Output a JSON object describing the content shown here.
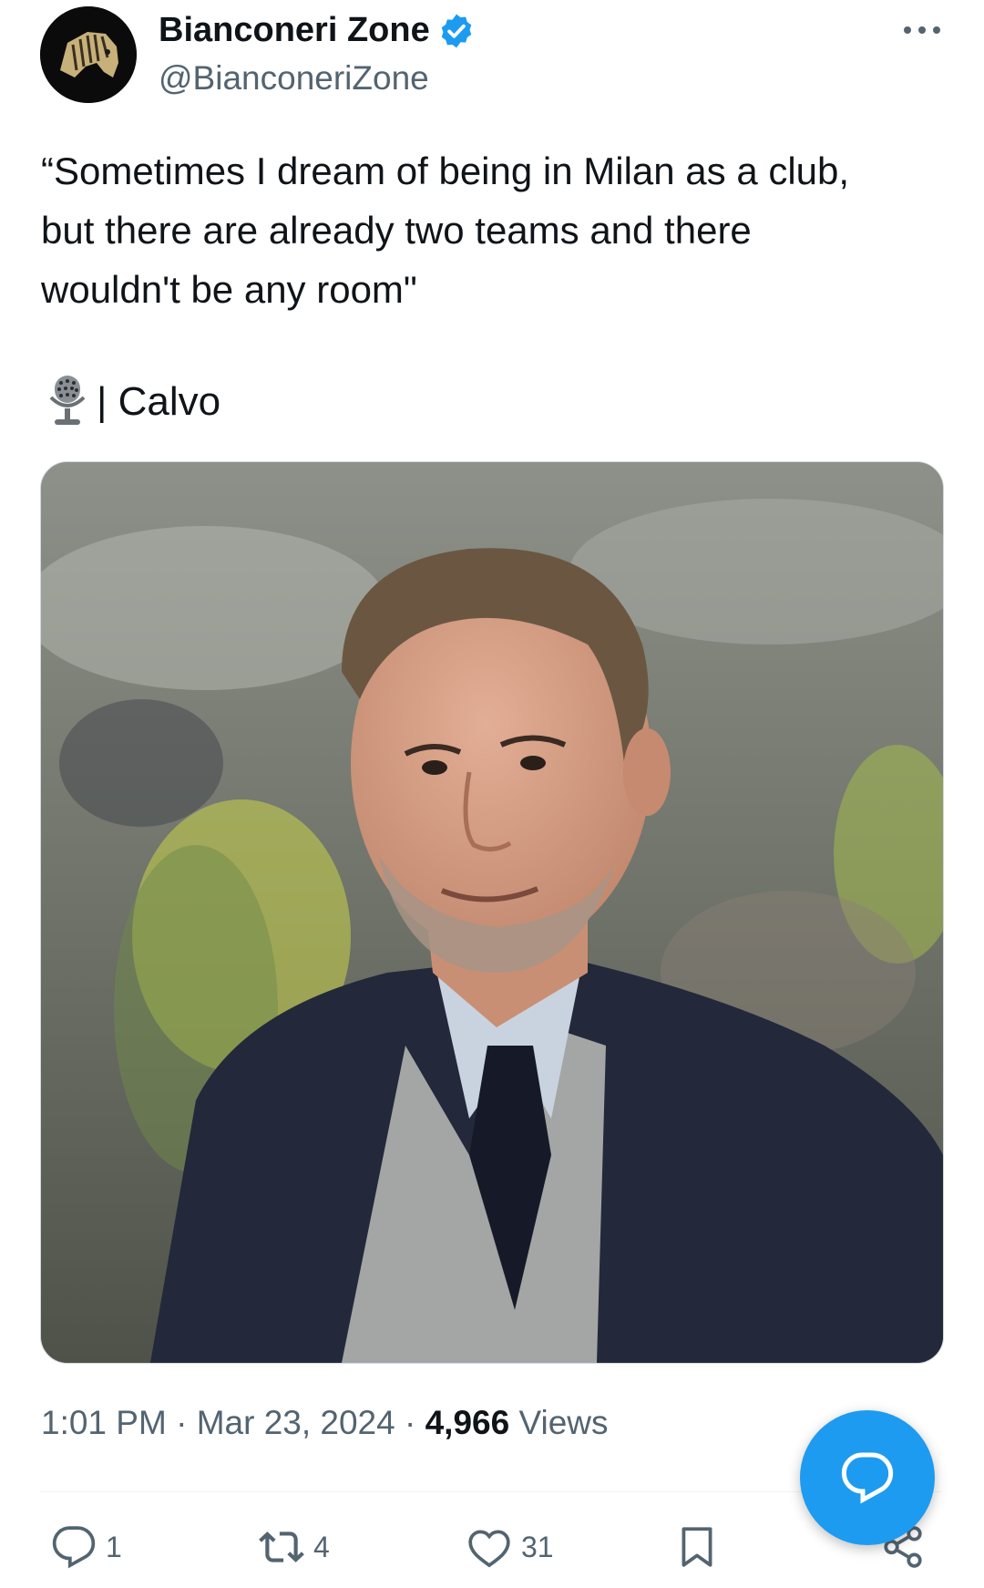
{
  "author": {
    "display_name": "Bianconeri Zone",
    "handle": "@BianconeriZone",
    "verified": true
  },
  "tweet": {
    "lines": [
      "“Sometimes I dream of being in Milan as a club,",
      "but there are already two teams and there",
      "wouldn't be any room\""
    ],
    "source": "| Calvo"
  },
  "meta": {
    "time": "1:01 PM",
    "date": "Mar 23, 2024",
    "separator": "·",
    "views_count": "4,966",
    "views_label": "Views"
  },
  "actions": {
    "replies": "1",
    "retweets": "4",
    "likes": "31"
  },
  "icons": [
    "avatar",
    "verified-icon",
    "more-icon",
    "microphone-icon",
    "reply-icon",
    "retweet-icon",
    "like-icon",
    "bookmark-icon",
    "share-icon",
    "compose-icon"
  ],
  "colors": {
    "accent": "#1d9bf0",
    "text": "#0f1419",
    "secondary": "#536471"
  }
}
